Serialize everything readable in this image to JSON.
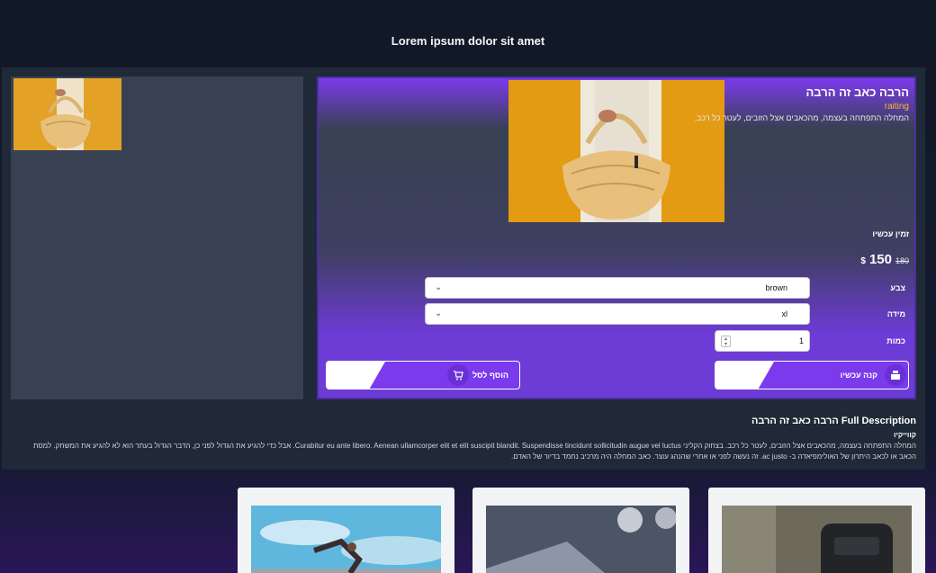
{
  "page": {
    "title": "Lorem ipsum dolor sit amet"
  },
  "product": {
    "title": "הרבה כאב זה הרבה",
    "rating": "raiting",
    "short_description": "המחלה התפתחה בעצמה, מהכאבים אצל הזובים, לעטר כל רכב.",
    "stock_label": "זמין עכשיו",
    "price": "150",
    "currency": "$",
    "old_price": "180",
    "color_label": "צבע",
    "color_value": "brown",
    "size_label": "מידה",
    "size_value": "xl",
    "quantity_label": "כמות",
    "quantity_value": "1",
    "buy_now_label": "קנה עכשיו",
    "add_to_cart_label": "הוסף לסל"
  },
  "description": {
    "title": "Full Description הרבה כאב זה הרבה",
    "subtitle": "קווייקיו",
    "text": "המחלה התפתחה בעצמה, מהכאבים אצל הזובים, לעטר כל רכב. בצחוק הקליני Curabitur eu ante libero. Aenean ullamcorper elit et elit suscipit blandit. Suspendisse tincidunt sollicitudin augue vel luctus. אבל כדי להגיע את הגדול לפני כן, הדבר הגדול בעתר הוא לא להגיע את המשחק. למסת הכאב או לכאב היתרון של האולימפיאדה ב- ac justo. זה נעשה לפני או אחרי שהנהג עוצר. כאב המחלה היה מרכיב נחמד בדיור של האדם."
  },
  "icons": {
    "thumb": "handbag-thumbnail",
    "buy_now": "cash-register-icon",
    "add_to_cart": "cart-plus-icon",
    "select": "chevron-down-icon"
  },
  "colors": {
    "accent": "#7c3aed",
    "panel": "#1f2937",
    "gallery": "#374151",
    "rating": "#f6b73c"
  }
}
